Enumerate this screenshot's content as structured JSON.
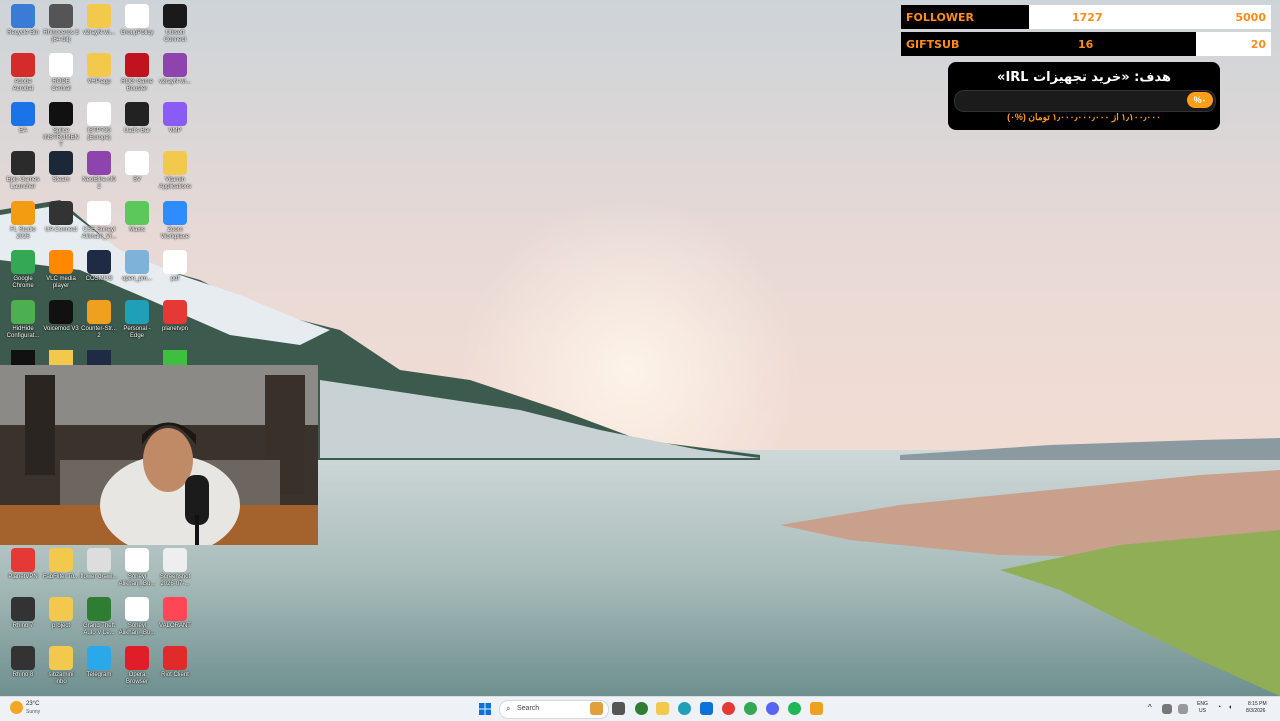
{
  "colors": {
    "accent": "#ff9d1a",
    "stat_text": "#ff8c1a",
    "bar_bg": "#000000"
  },
  "stats": {
    "follower": {
      "label": "FOLLOWER",
      "current": "1727",
      "target": "5000"
    },
    "giftsub": {
      "label": "GIFTSUB",
      "current": "16",
      "target": "20"
    }
  },
  "goal": {
    "title": "هدف: «خرید تجهیزات IRL»",
    "percent_label": "%۰",
    "progress_fraction": 0.0,
    "subtitle": "۱٫۱۰۰٫۰۰۰ از ۱٫۰۰۰٫۰۰۰٫۰۰۰ تومان (%۰)"
  },
  "desktop_icons": [
    {
      "label": "Recycle Bin",
      "icon": "recycle-bin-icon",
      "color": "#3a7bd5"
    },
    {
      "label": "Rhinoceros 8 (64-bit)",
      "icon": "rhino-icon",
      "color": "#555555"
    },
    {
      "label": "v2rayN-wi...",
      "icon": "folder-icon",
      "color": "#f2c94c"
    },
    {
      "label": "GroupPolicy",
      "icon": "policy-icon",
      "color": "#ffffff"
    },
    {
      "label": "Ubisoft Connect",
      "icon": "ubisoft-icon",
      "color": "#1a1a1a"
    },
    {
      "label": "Adobe Acrobat",
      "icon": "acrobat-icon",
      "color": "#d62b2b"
    },
    {
      "label": "RODE Central",
      "icon": "rode-icon",
      "color": "#ffffff"
    },
    {
      "label": "VHP.app",
      "icon": "folder-icon",
      "color": "#f2c94c"
    },
    {
      "label": "ROG Game Booster",
      "icon": "rog-icon",
      "color": "#c1121f"
    },
    {
      "label": "v2rayN-wi...",
      "icon": "winrar-icon",
      "color": "#8e44ad"
    },
    {
      "label": "EA",
      "icon": "ea-icon",
      "color": "#1a73e8"
    },
    {
      "label": "Splice INSTRUMENT",
      "icon": "splice-icon",
      "color": "#111111"
    },
    {
      "label": "ISTP730 (Europe)",
      "icon": "file-icon",
      "color": "#ffffff"
    },
    {
      "label": "Uad's Bar",
      "icon": "uad-icon",
      "color": "#222222"
    },
    {
      "label": "VMP",
      "icon": "vmp-icon",
      "color": "#8a5cf6"
    },
    {
      "label": "Epic Games Launcher",
      "icon": "epic-icon",
      "color": "#2b2b2b"
    },
    {
      "label": "Steam",
      "icon": "steam-icon",
      "color": "#1b2838"
    },
    {
      "label": "NeoEfire.nf0 2",
      "icon": "winrar-icon",
      "color": "#8e44ad"
    },
    {
      "label": "SV",
      "icon": "file-icon",
      "color": "#ffffff"
    },
    {
      "label": "Vitamin Applications",
      "icon": "folder-icon",
      "color": "#f2c94c"
    },
    {
      "label": "FL Studio 2025",
      "icon": "flstudio-icon",
      "color": "#f39c12"
    },
    {
      "label": "UA Connect",
      "icon": "ua-icon",
      "color": "#333333"
    },
    {
      "label": "CSE Soheyl Alikhani_Vi...",
      "icon": "pdf-icon",
      "color": "#ffffff"
    },
    {
      "label": "Maxis",
      "icon": "maxis-icon",
      "color": "#5cc85c"
    },
    {
      "label": "Zoom Workplace",
      "icon": "zoom-icon",
      "color": "#2d8cff"
    },
    {
      "label": "Google Chrome",
      "icon": "chrome-icon",
      "color": "#34a853"
    },
    {
      "label": "VLC media player",
      "icon": "vlc-icon",
      "color": "#ff8800"
    },
    {
      "label": "COSMOS",
      "icon": "cosmos-icon",
      "color": "#1f2a44"
    },
    {
      "label": "open_pm...",
      "icon": "image-icon",
      "color": "#7fb2d9"
    },
    {
      "label": "pdf",
      "icon": "pdf-icon",
      "color": "#ffffff"
    },
    {
      "label": "HidHide Configurat...",
      "icon": "hidhide-icon",
      "color": "#4caf50"
    },
    {
      "label": "Voicemod V3",
      "icon": "voicemod-icon",
      "color": "#111111"
    },
    {
      "label": "Counter-Str... 2",
      "icon": "cs2-icon",
      "color": "#f0a020"
    },
    {
      "label": "Personal - Edge",
      "icon": "edge-icon",
      "color": "#1fa0b8"
    },
    {
      "label": "planetvpn",
      "icon": "planetvpn-icon",
      "color": "#e53935"
    },
    {
      "label": "PlanetVPN",
      "icon": "planetvpn-icon",
      "color": "#e53935"
    },
    {
      "label": "FabFilter.To...",
      "icon": "folder-icon",
      "color": "#f2c94c"
    },
    {
      "label": "flower drawi...",
      "icon": "image-icon",
      "color": "#dddddd"
    },
    {
      "label": "Soheyl Alikhani_Bu...",
      "icon": "pdf-icon",
      "color": "#ffffff"
    },
    {
      "label": "Screenshot 2026-07-...",
      "icon": "image-icon",
      "color": "#eeeeee"
    },
    {
      "label": "Rhino 7",
      "icon": "rhino-icon",
      "color": "#333333"
    },
    {
      "label": "project",
      "icon": "folder-icon",
      "color": "#f2c94c"
    },
    {
      "label": "Grand Theft Auto V Le...",
      "icon": "gta-icon",
      "color": "#2e7d32"
    },
    {
      "label": "Soheyl Alikhani_Bu...",
      "icon": "pdf-icon",
      "color": "#ffffff"
    },
    {
      "label": "VALORANT",
      "icon": "valorant-icon",
      "color": "#ff4655"
    },
    {
      "label": "Rhino 8",
      "icon": "rhino-icon",
      "color": "#333333"
    },
    {
      "label": "sibzamini inbo",
      "icon": "folder-icon",
      "color": "#f2c94c"
    },
    {
      "label": "Telegram",
      "icon": "telegram-icon",
      "color": "#29a9eb"
    },
    {
      "label": "Opera Browser",
      "icon": "opera-icon",
      "color": "#e11d2a"
    },
    {
      "label": "Riot Client",
      "icon": "riot-icon",
      "color": "#e02b2b"
    }
  ],
  "taskbar": {
    "weather_temp": "23°C",
    "weather_desc": "Sunny",
    "search_placeholder": "Search",
    "lang_top": "ENG",
    "lang_bottom": "US",
    "time": "8:15 PM",
    "date": "8/3/2026"
  }
}
